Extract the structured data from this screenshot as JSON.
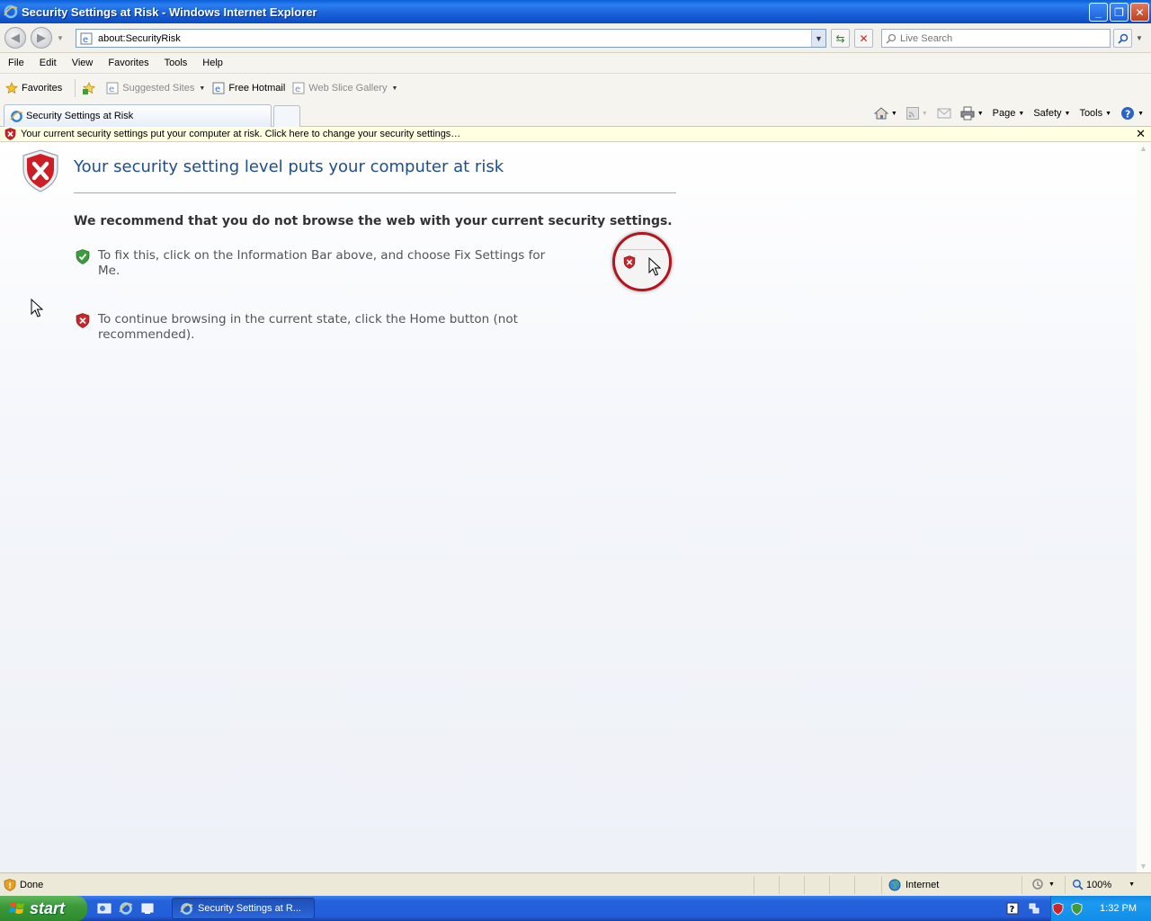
{
  "window": {
    "title": "Security Settings at Risk - Windows Internet Explorer",
    "buttons": [
      "minimize",
      "restore",
      "close"
    ]
  },
  "address_bar": {
    "url": "about:SecurityRisk",
    "search_placeholder": "Live Search"
  },
  "menu": [
    "File",
    "Edit",
    "View",
    "Favorites",
    "Tools",
    "Help"
  ],
  "favorites_bar": {
    "favorites_label": "Favorites",
    "items": [
      {
        "label": "Suggested Sites",
        "dimmed": true,
        "dropdown": true
      },
      {
        "label": "Free Hotmail",
        "dimmed": false,
        "dropdown": false
      },
      {
        "label": "Web Slice Gallery",
        "dimmed": true,
        "dropdown": true
      }
    ]
  },
  "tab": {
    "title": "Security Settings at Risk"
  },
  "command_bar": {
    "page": "Page",
    "safety": "Safety",
    "tools": "Tools"
  },
  "info_bar": {
    "text": "Your current security settings put your computer at risk. Click here to change your security settings…"
  },
  "content": {
    "heading": "Your security setting level puts your computer at risk",
    "recommendation": "We recommend that you do not browse the web with your current security settings.",
    "bullets": [
      {
        "icon": "green-shield-check-icon",
        "text": "To fix this, click on the Information Bar above, and choose Fix Settings for Me."
      },
      {
        "icon": "red-shield-x-icon",
        "text": "To continue browsing in the current state, click the Home button (not recommended)."
      }
    ]
  },
  "status_bar": {
    "status": "Done",
    "zone": "Internet",
    "zoom": "100%"
  },
  "taskbar": {
    "start": "start",
    "active_item": "Security Settings at R...",
    "clock": "1:32 PM"
  },
  "colors": {
    "title_blue": "#0a5fd8",
    "heading_blue": "#1f4e8c",
    "infobar_yellow": "#ffffe1",
    "callout_red": "#b4141e"
  }
}
